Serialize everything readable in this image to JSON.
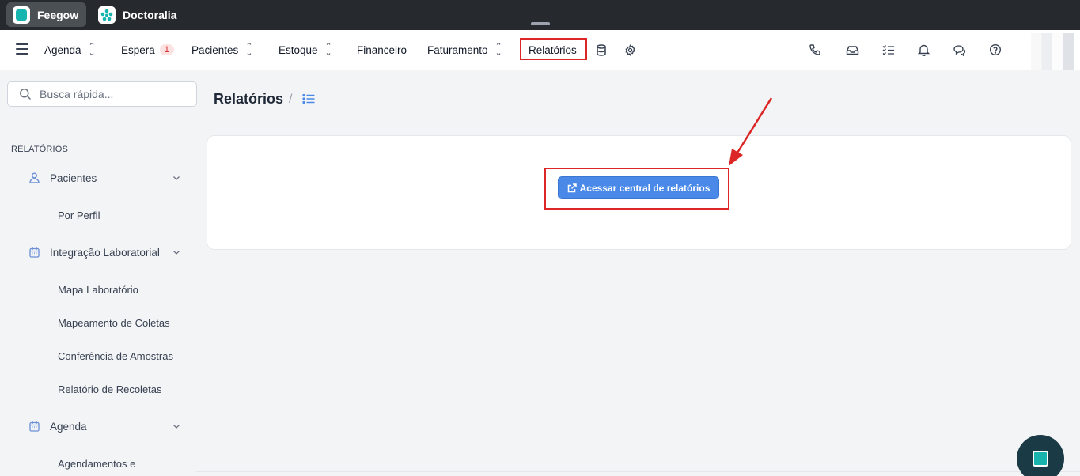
{
  "appbar": {
    "tabs": [
      {
        "label": "Feegow",
        "icon": "feegow-logo",
        "active": true
      },
      {
        "label": "Doctoralia",
        "icon": "doctoralia-logo",
        "active": false
      }
    ]
  },
  "nav": {
    "items": [
      {
        "label": "Agenda",
        "dropdown": true
      },
      {
        "label": "Espera",
        "badge": "1"
      },
      {
        "label": "Pacientes",
        "dropdown": true
      },
      {
        "label": "Estoque",
        "dropdown": true
      },
      {
        "label": "Financeiro"
      },
      {
        "label": "Faturamento",
        "dropdown": true
      },
      {
        "label": "Relatórios",
        "active": true
      }
    ],
    "extra_icons": [
      "database-icon",
      "gear-icon"
    ],
    "right_icons": [
      "phone-icon",
      "inbox-icon",
      "checklist-icon",
      "bell-icon",
      "chat-icon",
      "help-icon",
      "avatar"
    ],
    "highlight_color": "#dc2626"
  },
  "sidebar": {
    "search": {
      "placeholder": "Busca rápida..."
    },
    "section_title": "RELATÓRIOS",
    "groups": [
      {
        "label": "Pacientes",
        "icon": "user-icon",
        "links": [
          "Por Perfil"
        ]
      },
      {
        "label": "Integração Laboratorial",
        "icon": "calendar-icon",
        "links": [
          "Mapa Laboratório",
          "Mapeamento de Coletas",
          "Conferência de Amostras",
          "Relatório de Recoletas"
        ]
      },
      {
        "label": "Agenda",
        "icon": "calendar-icon",
        "links": [
          "Agendamentos e"
        ]
      }
    ]
  },
  "main": {
    "title": "Relatórios",
    "breadcrumb_separator": "/",
    "action_button": {
      "label": "Acessar central de relatórios",
      "icon": "external-link-icon",
      "color": "#4a89e8"
    }
  }
}
